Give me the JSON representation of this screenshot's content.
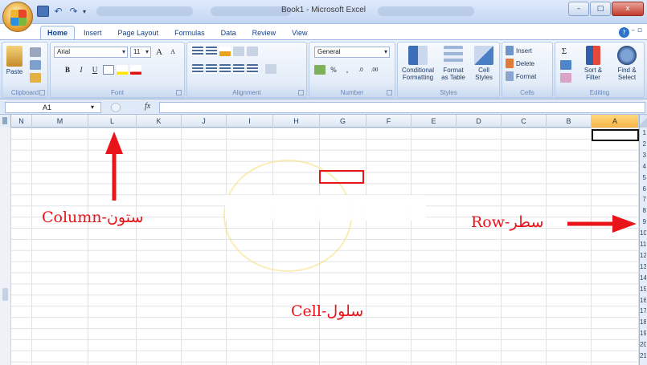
{
  "window": {
    "title": "Book1 - Microsoft Excel",
    "controls": {
      "minimize": "–",
      "maximize": "□",
      "close": "x"
    }
  },
  "quick_access": {
    "undo": "↶",
    "redo": "↷",
    "dropdown": "▾"
  },
  "ribbon": {
    "tabs": [
      "Home",
      "Insert",
      "Page Layout",
      "Formulas",
      "Data",
      "Review",
      "View"
    ],
    "active_tab": "Home",
    "help": "?",
    "minimize_controls": "–  ▫",
    "groups": {
      "clipboard": {
        "label": "Clipboard",
        "paste": "Paste"
      },
      "font": {
        "label": "Font",
        "font_name": "Arial",
        "font_size": "11",
        "grow": "A",
        "shrink": "A",
        "bold": "B",
        "italic": "I",
        "underline": "U"
      },
      "alignment": {
        "label": "Alignment"
      },
      "number": {
        "label": "Number",
        "format": "General",
        "percent": "%",
        "comma": ",",
        "inc_decimal": ".0",
        "dec_decimal": ".00"
      },
      "styles": {
        "label": "Styles",
        "conditional_formatting": [
          "Conditional",
          "Formatting"
        ],
        "format_as_table": [
          "Format",
          "as Table"
        ],
        "cell_styles": [
          "Cell",
          "Styles"
        ]
      },
      "cells": {
        "label": "Cells",
        "insert": "Insert",
        "delete": "Delete",
        "format": "Format"
      },
      "editing": {
        "label": "Editing",
        "sigma": "Σ",
        "sort_filter": [
          "Sort &",
          "Filter"
        ],
        "find_select": [
          "Find &",
          "Select"
        ]
      }
    }
  },
  "formula_bar": {
    "name_box": "A1",
    "fx": "fx",
    "formula": ""
  },
  "sheet": {
    "columns": [
      "N",
      "M",
      "L",
      "K",
      "J",
      "I",
      "H",
      "G",
      "F",
      "E",
      "D",
      "C",
      "B",
      "A"
    ],
    "selected_column": "A",
    "active_cell": "A1",
    "row_numbers": [
      "1",
      "2",
      "3",
      "4",
      "5",
      "6",
      "7",
      "8",
      "9",
      "10",
      "11",
      "12",
      "13",
      "14",
      "15",
      "16",
      "17",
      "18",
      "19",
      "20",
      "21"
    ]
  },
  "annotations": {
    "column": "Column-ستون",
    "row": "Row-سطر",
    "cell": "Cell-سلول",
    "arrow_color": "#e8141a"
  }
}
